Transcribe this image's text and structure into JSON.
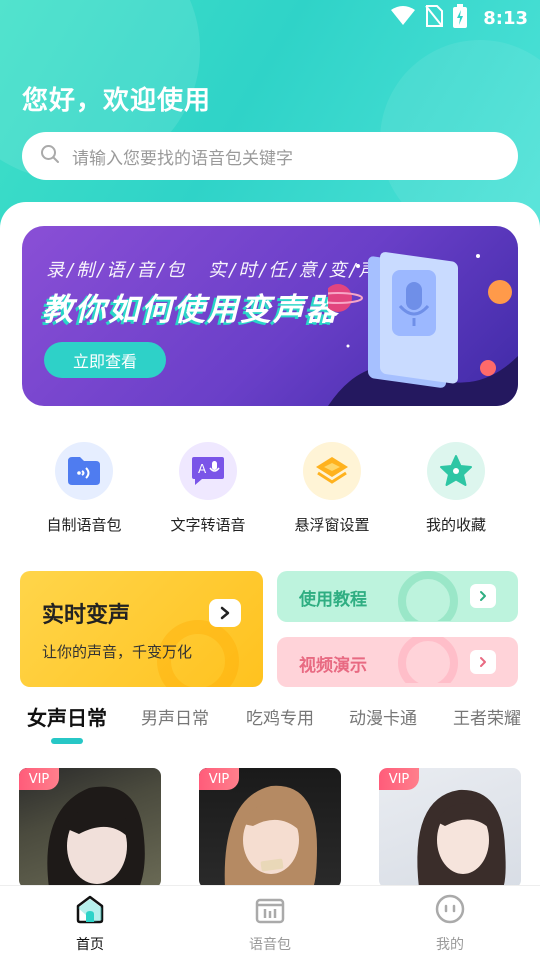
{
  "status_bar": {
    "time": "8:13"
  },
  "header": {
    "greeting": "您好，欢迎使用",
    "search_placeholder": "请输入您要找的语音包关键字"
  },
  "banner": {
    "subtitle": "录/制/语/音/包　实/时/任/意/变/声",
    "headline": "教你如何使用变声器",
    "cta": "立即查看"
  },
  "features": [
    {
      "label": "自制语音包",
      "icon": "folder-voice-icon",
      "color": "#4f7cf0",
      "bg": "#e6eeff"
    },
    {
      "label": "文字转语音",
      "icon": "text-to-speech-icon",
      "color": "#7a55e8",
      "bg": "#efe8ff"
    },
    {
      "label": "悬浮窗设置",
      "icon": "layers-icon",
      "color": "#ffb21e",
      "bg": "#fff4d6"
    },
    {
      "label": "我的收藏",
      "icon": "star-icon",
      "color": "#2ec6a4",
      "bg": "#ddf6ee"
    }
  ],
  "cards": {
    "realtime": {
      "title": "实时变声",
      "desc": "让你的声音，千变万化"
    },
    "tutorial": {
      "title": "使用教程",
      "color": "#2fae82"
    },
    "video": {
      "title": "视频演示",
      "color": "#e86a82"
    }
  },
  "tabs": [
    "女声日常",
    "男声日常",
    "吃鸡专用",
    "动漫卡通",
    "王者荣耀"
  ],
  "active_tab": "女声日常",
  "voice_cards": [
    {
      "badge": "VIP"
    },
    {
      "badge": "VIP"
    },
    {
      "badge": "VIP"
    }
  ],
  "bottom_nav": [
    {
      "label": "首页",
      "icon": "home-icon",
      "active": true
    },
    {
      "label": "语音包",
      "icon": "voice-pack-icon",
      "active": false
    },
    {
      "label": "我的",
      "icon": "profile-icon",
      "active": false
    }
  ]
}
